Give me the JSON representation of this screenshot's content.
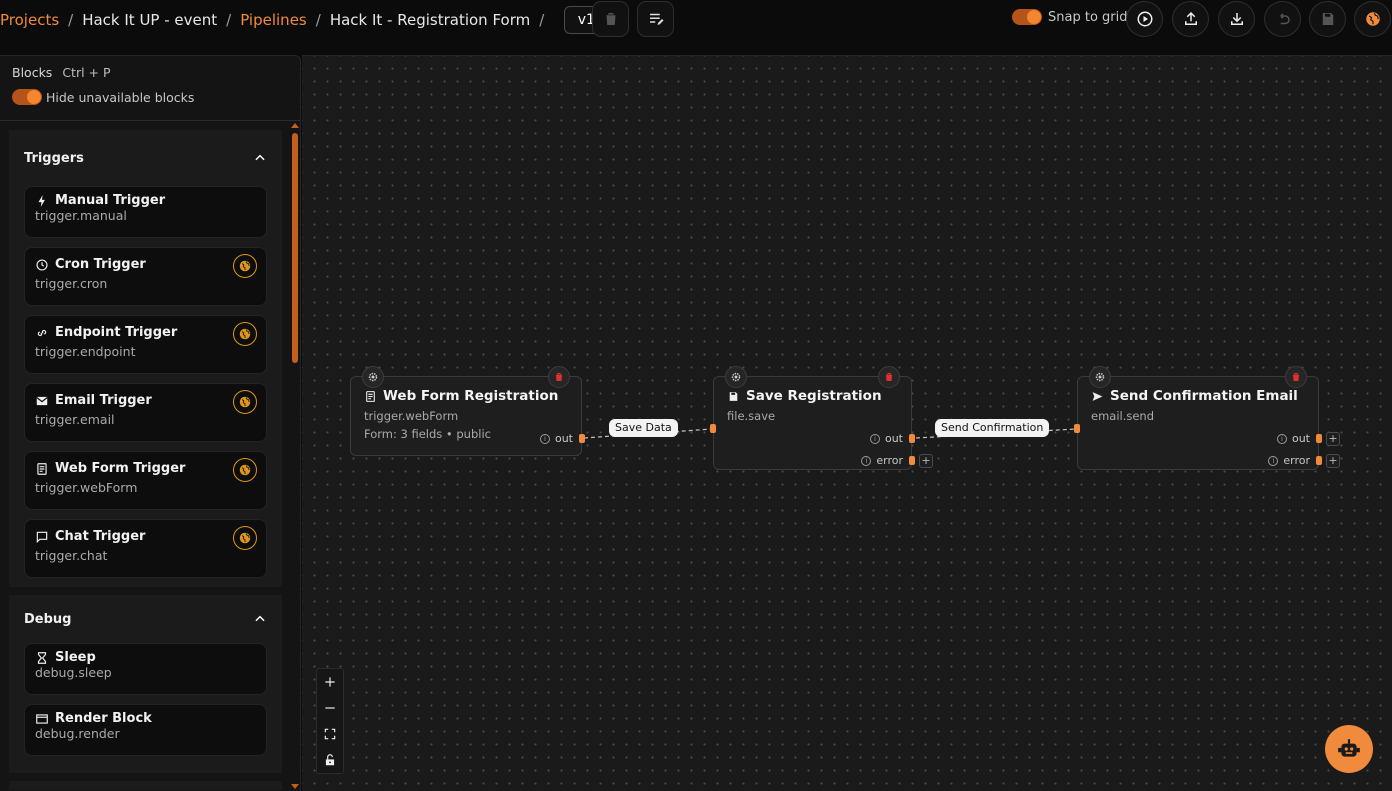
{
  "breadcrumb": {
    "items": [
      {
        "label": "Projects",
        "link": true
      },
      {
        "label": "Hack It UP - event",
        "link": false
      },
      {
        "label": "Pipelines",
        "link": true
      },
      {
        "label": "Hack It - Registration Form",
        "link": false
      }
    ],
    "separator": "/"
  },
  "version": {
    "selected": "v1"
  },
  "toolbar": {
    "snap_label": "Snap to grid",
    "snap_enabled": true,
    "buttons": [
      "trash-icon",
      "edit-list-icon",
      "play-icon",
      "upload-icon",
      "download-icon",
      "undo-icon",
      "save-icon",
      "globe-icon"
    ]
  },
  "sidebar": {
    "title": "Blocks",
    "shortcut": "Ctrl + P",
    "hide_unavailable_label": "Hide unavailable blocks",
    "sections": [
      {
        "title": "Triggers",
        "blocks": [
          {
            "name": "Manual Trigger",
            "type": "trigger.manual",
            "icon": "bolt-icon",
            "public": false
          },
          {
            "name": "Cron Trigger",
            "type": "trigger.cron",
            "icon": "clock-icon",
            "public": true
          },
          {
            "name": "Endpoint Trigger",
            "type": "trigger.endpoint",
            "icon": "link-icon",
            "public": true
          },
          {
            "name": "Email Trigger",
            "type": "trigger.email",
            "icon": "mail-icon",
            "public": true
          },
          {
            "name": "Web Form Trigger",
            "type": "trigger.webForm",
            "icon": "form-icon",
            "public": true
          },
          {
            "name": "Chat Trigger",
            "type": "trigger.chat",
            "icon": "chat-icon",
            "public": true
          }
        ]
      },
      {
        "title": "Debug",
        "blocks": [
          {
            "name": "Sleep",
            "type": "debug.sleep",
            "icon": "hourglass-icon",
            "public": false
          },
          {
            "name": "Render Block",
            "type": "debug.render",
            "icon": "window-icon",
            "public": false
          }
        ]
      }
    ]
  },
  "canvas": {
    "nodes": [
      {
        "title": "Web Form Registration",
        "type": "trigger.webForm",
        "desc": "Form: 3 fields • public",
        "icon": "form-icon",
        "outputs": [
          "out"
        ]
      },
      {
        "title": "Save Registration",
        "type": "file.save",
        "desc": "",
        "icon": "save-icon",
        "outputs": [
          "out",
          "error"
        ]
      },
      {
        "title": "Send Confirmation Email",
        "type": "email.send",
        "desc": "",
        "icon": "send-icon",
        "outputs": [
          "out",
          "error"
        ]
      }
    ],
    "edges": [
      {
        "label": "Save Data"
      },
      {
        "label": "Send Confirmation"
      }
    ],
    "accent": "#f08a3c"
  }
}
